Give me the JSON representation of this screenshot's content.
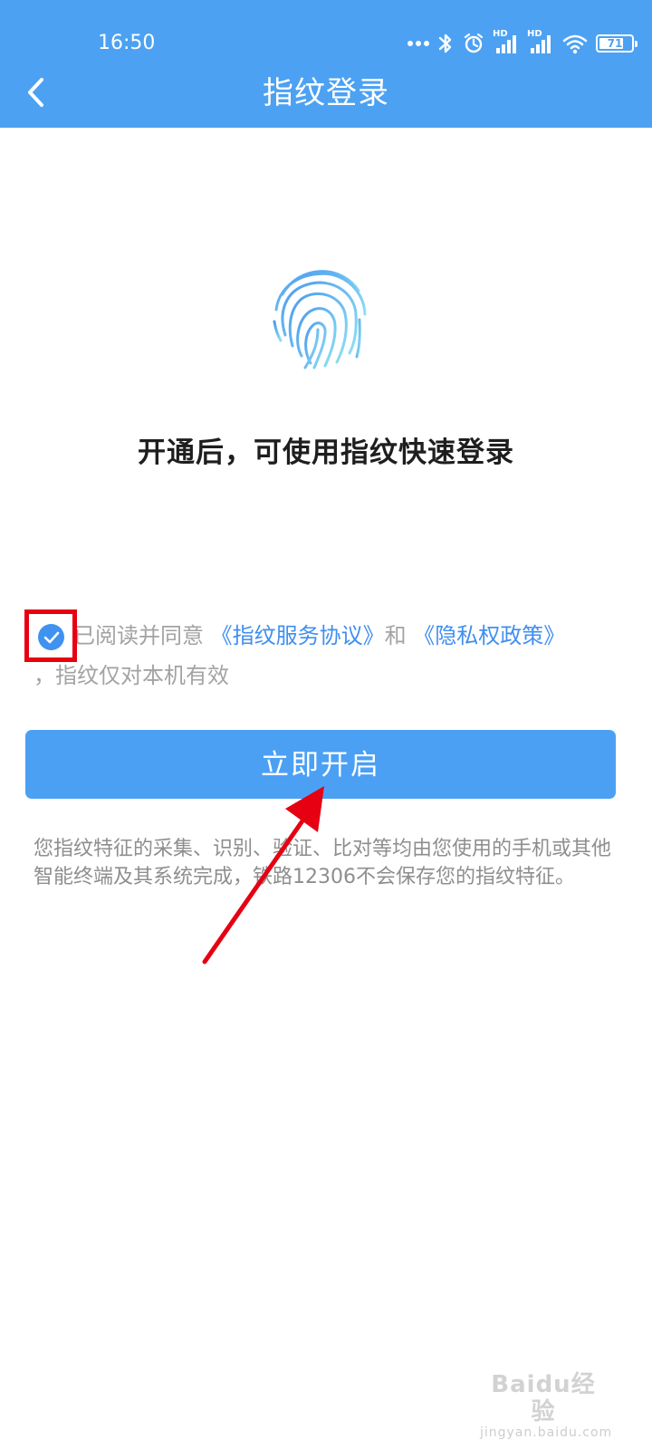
{
  "status_bar": {
    "time": "16:50",
    "signal_label_1": "HD",
    "signal_label_2": "HD",
    "battery": "71"
  },
  "header": {
    "title": "指纹登录"
  },
  "main": {
    "headline": "开通后，可使用指纹快速登录",
    "agreement": {
      "prefix": "已阅读并同意",
      "link_service": "《指纹服务协议》",
      "middle": "和",
      "link_privacy": "《隐私权政策》",
      "suffix": "，指纹仅对本机有效",
      "checked": true
    },
    "button_label": "立即开启",
    "disclaimer": "您指纹特征的采集、识别、验证、比对等均由您使用的手机或其他智能终端及其系统完成，铁路12306不会保存您的指纹特征。"
  },
  "watermark": {
    "main": "Baidu经验",
    "sub": "jingyan.baidu.com"
  },
  "colors": {
    "brand_blue": "#4ca1f2",
    "link_blue": "#3f8ff0",
    "annotation_red": "#e60012",
    "text_dark": "#1e1e1e",
    "text_gray": "#8e8e8e"
  },
  "icons": {
    "back": "chevron-left-icon",
    "fingerprint": "fingerprint-icon",
    "checkbox": "check-circle-icon",
    "annotation": "red-arrow-icon"
  }
}
